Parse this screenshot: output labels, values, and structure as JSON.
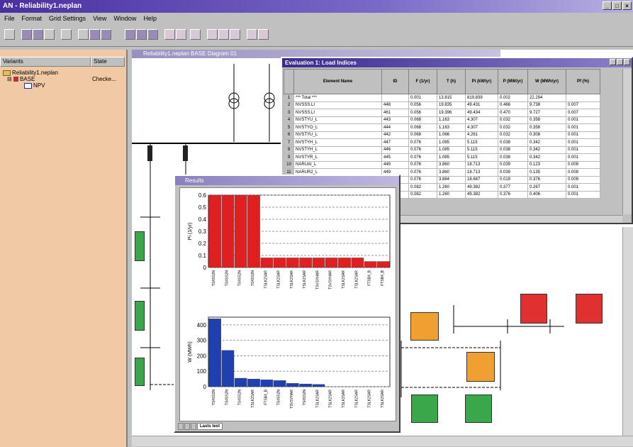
{
  "window": {
    "title": "AN - Reliability1.neplan"
  },
  "menu": [
    "File",
    "Format",
    "Grid Settings",
    "View",
    "Window",
    "Help"
  ],
  "left_panel": {
    "col1": "Variants",
    "col2": "State",
    "tree": [
      {
        "label": "Reliability1.neplan",
        "state": ""
      },
      {
        "label": "BASE",
        "state": "Checke..."
      },
      {
        "label": "NPV",
        "state": ""
      }
    ]
  },
  "canvas": {
    "title": "Reliability1.neplan BASE Diagram 01"
  },
  "evaluation": {
    "title": "Evaluation 1: Load Indices",
    "columns": [
      "Element Name",
      "ID",
      "F (1/yr)",
      "T (h)",
      "Pi (kW/yr)",
      "P (MW/yr)",
      "W (MWh/yr)",
      "Pf (%)"
    ],
    "rows": [
      [
        "1",
        "*** Total ***",
        "",
        "0.001",
        "13.815",
        "819.839",
        "0.002",
        "22.294",
        ""
      ],
      [
        "2",
        "NVSSS.LI",
        "448",
        "0.056",
        "19.835",
        "49.431",
        "0.466",
        "9.738",
        "0.007"
      ],
      [
        "3",
        "NVSSS.LI",
        "461",
        "0.056",
        "19.396",
        "49.434",
        "0.470",
        "9.727",
        "0.007"
      ],
      [
        "4",
        "NVSTYU_L",
        "443",
        "0.068",
        "1.163",
        "4.307",
        "0.032",
        "0.358",
        "0.001"
      ],
      [
        "5",
        "NVSTYO_L",
        "444",
        "0.068",
        "1.163",
        "4.307",
        "0.032",
        "0.358",
        "0.001"
      ],
      [
        "6",
        "NVSTYU_L",
        "442",
        "0.068",
        "1.066",
        "4.261",
        "0.032",
        "0.308",
        "0.001"
      ],
      [
        "7",
        "NVSTYH_L",
        "447",
        "0.076",
        "1.085",
        "5.115",
        "0.038",
        "0.342",
        "0.001"
      ],
      [
        "8",
        "NVSTYH_L",
        "446",
        "0.076",
        "1.085",
        "5.115",
        "0.038",
        "0.342",
        "0.001"
      ],
      [
        "9",
        "NVSTYR_L",
        "445",
        "0.076",
        "1.085",
        "5.115",
        "0.038",
        "0.342",
        "0.001"
      ],
      [
        "10",
        "NARUAI_L",
        "449",
        "0.076",
        "3.860",
        "18.713",
        "0.039",
        "0.123",
        "0.009"
      ],
      [
        "11",
        "NARUR2_L",
        "449",
        "0.076",
        "3.860",
        "18.713",
        "0.039",
        "0.135",
        "0.009"
      ],
      [
        "12",
        "NARUA3_L",
        "450",
        "0.076",
        "3.884",
        "18.687",
        "0.019",
        "0.376",
        "0.009"
      ],
      [
        "13",
        "NARUA4_L",
        "451",
        "0.082",
        "1.260",
        "49.382",
        "0.377",
        "0.267",
        "0.001"
      ],
      [
        "14",
        "NARUA5_L",
        "452",
        "0.082",
        "1.260",
        "49.382",
        "0.376",
        "0.406",
        "0.001"
      ]
    ]
  },
  "results": {
    "title": "Results",
    "tabs": [
      "",
      "",
      "",
      "Lasts text"
    ]
  },
  "chart_data": [
    {
      "type": "bar",
      "ylabel": "Pi (1/yr)",
      "ylim": [
        0,
        0.6
      ],
      "yticks": [
        "0",
        "0.1",
        "0.2",
        "0.3",
        "0.4",
        "0.5",
        "0.6"
      ],
      "color": "#e02020",
      "categories": [
        "TS4SS2N",
        "TS4SS2N",
        "TS4SS2N",
        "TS4SS2N",
        "TSLK2SAR",
        "TSLK2SAR",
        "TSLK2SAR",
        "TSLK2SAR",
        "TSVSYHAR",
        "TSVSYHAR",
        "TSLK2SAR",
        "TSLK2SAR",
        "FTSB4_B",
        "FTSB4_B"
      ],
      "values": [
        0.6,
        0.6,
        0.6,
        0.6,
        0.08,
        0.08,
        0.08,
        0.08,
        0.08,
        0.08,
        0.08,
        0.08,
        0.05,
        0.05
      ]
    },
    {
      "type": "bar",
      "ylabel": "W (MWh)",
      "ylim": [
        0,
        450
      ],
      "yticks": [
        "0",
        "100",
        "200",
        "300",
        "400"
      ],
      "color": "#2040b0",
      "categories": [
        "TS4SS2N",
        "TS4SS2N",
        "TS4SS2N",
        "TSLK2SAR",
        "FTSB4_B",
        "TS4SS2N",
        "TSVSYHAR",
        "TS4SS2N",
        "TSLK2SAR",
        "TSLK2SAR",
        "TSLK2SAR",
        "TSLK2SAR",
        "TSLK2SAR",
        "TSLK2SAR"
      ],
      "values": [
        440,
        235,
        55,
        50,
        45,
        40,
        22,
        18,
        15,
        0,
        0,
        0,
        0,
        0
      ]
    }
  ],
  "colors": {
    "titlebar": "#4a2fa0",
    "left_panel": "#f2c9a5",
    "green_box": "#3aa84a",
    "orange_box": "#f0a030",
    "red_box": "#e03030"
  }
}
